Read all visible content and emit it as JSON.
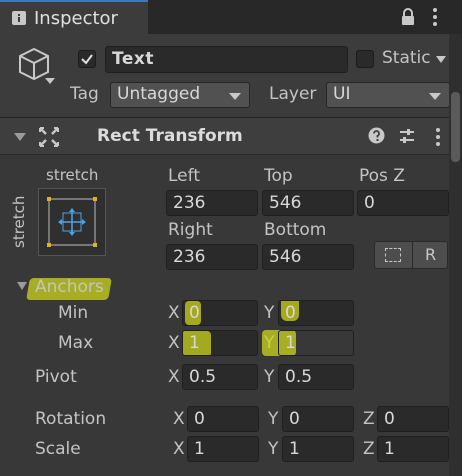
{
  "tab": {
    "title": "Inspector",
    "icon": "info-icon"
  },
  "header": {
    "active": true,
    "name": "Text",
    "static_label": "Static",
    "tag_label": "Tag",
    "tag_value": "Untagged",
    "layer_label": "Layer",
    "layer_value": "UI"
  },
  "component": {
    "title": "Rect Transform"
  },
  "anchor_preset": {
    "horizontal": "stretch",
    "vertical": "stretch"
  },
  "position": {
    "left_label": "Left",
    "left_value": "236",
    "top_label": "Top",
    "top_value": "546",
    "posz_label": "Pos Z",
    "posz_value": "0",
    "right_label": "Right",
    "right_value": "236",
    "bottom_label": "Bottom",
    "bottom_value": "546",
    "raw_button": "R"
  },
  "anchors": {
    "label": "Anchors",
    "min_label": "Min",
    "min_x": "0",
    "min_y": "0",
    "max_label": "Max",
    "max_x": "1",
    "max_y": "1"
  },
  "pivot": {
    "label": "Pivot",
    "x": "0.5",
    "y": "0.5"
  },
  "rotation": {
    "label": "Rotation",
    "x": "0",
    "y": "0",
    "z": "0"
  },
  "scale": {
    "label": "Scale",
    "x": "1",
    "y": "1",
    "z": "1"
  },
  "axes": {
    "x": "X",
    "y": "Y",
    "z": "Z"
  },
  "colors": {
    "highlight": "#cdd61c",
    "accent": "#3a79bb",
    "anchor_handle": "#e0b020"
  }
}
